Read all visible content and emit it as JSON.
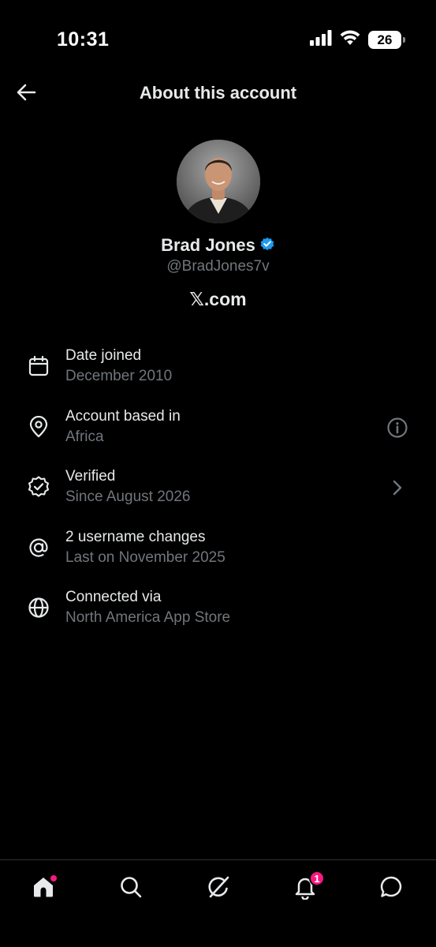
{
  "status_bar": {
    "time": "10:31",
    "battery_level": "26",
    "icons": [
      "signal-icon",
      "wifi-icon",
      "battery-icon"
    ]
  },
  "header": {
    "title": "About this account",
    "back_icon": "arrow-left-icon"
  },
  "profile": {
    "name": "Brad Jones",
    "handle": "@BradJones7v",
    "site": "𝕏.com",
    "verified": true,
    "verified_color": "#1d9bf0"
  },
  "info_items": [
    {
      "icon": "calendar-icon",
      "label": "Date joined",
      "value": "December 2010"
    },
    {
      "icon": "location-pin-icon",
      "label": "Account based in",
      "value": "Africa",
      "trailing": "info-icon"
    },
    {
      "icon": "verified-badge-icon",
      "label": "Verified",
      "value": "Since August 2026",
      "trailing": "chevron-right-icon"
    },
    {
      "icon": "at-sign-icon",
      "label": "2 username changes",
      "value": "Last on November 2025"
    },
    {
      "icon": "globe-icon",
      "label": "Connected via",
      "value": "North America App Store"
    }
  ],
  "bottom_nav": {
    "items": [
      {
        "icon": "home-icon",
        "has_dot": true
      },
      {
        "icon": "search-icon"
      },
      {
        "icon": "grok-icon"
      },
      {
        "icon": "bell-icon",
        "badge": "1"
      },
      {
        "icon": "message-icon"
      }
    ],
    "accent_color": "#f91880"
  },
  "colors": {
    "background": "#000000",
    "primary_text": "#e7e9ea",
    "secondary_text": "#71767b",
    "divider": "#2f3336"
  }
}
